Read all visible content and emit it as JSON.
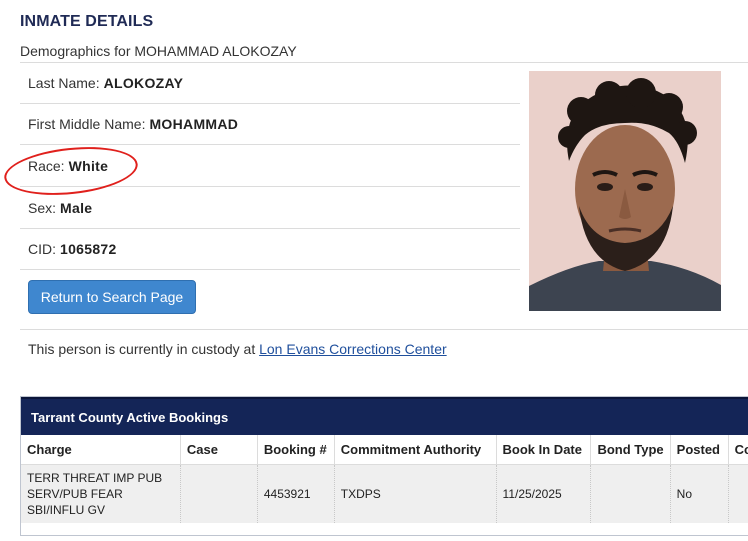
{
  "header": {
    "title": "INMATE DETAILS",
    "subtitle": "Demographics for MOHAMMAD ALOKOZAY"
  },
  "fields": [
    {
      "label": "Last Name:",
      "value": "ALOKOZAY"
    },
    {
      "label": "First Middle Name:",
      "value": "MOHAMMAD"
    },
    {
      "label": "Race:",
      "value": "White"
    },
    {
      "label": "Sex:",
      "value": "Male"
    },
    {
      "label": "CID:",
      "value": "1065872"
    }
  ],
  "actions": {
    "return_label": "Return to Search Page"
  },
  "custody": {
    "text": "This person is currently in custody at ",
    "link": "Lon Evans Corrections Center"
  },
  "bookings": {
    "title": "Tarrant County Active Bookings",
    "columns": [
      "Charge",
      "Case",
      "Booking #",
      "Commitment Authority",
      "Book In Date",
      "Bond Type",
      "Posted",
      "Co"
    ],
    "rows": [
      {
        "charge": "TERR THREAT IMP PUB SERV/PUB FEAR SBI/INFLU GV",
        "case": "",
        "booking": "4453921",
        "authority": "TXDPS",
        "book_in_date": "11/25/2025",
        "bond_type": "",
        "posted": "No",
        "co": ""
      }
    ]
  },
  "colors": {
    "accent": "#3f87cf",
    "panel_header": "#142557",
    "annotation": "#e0201c"
  }
}
